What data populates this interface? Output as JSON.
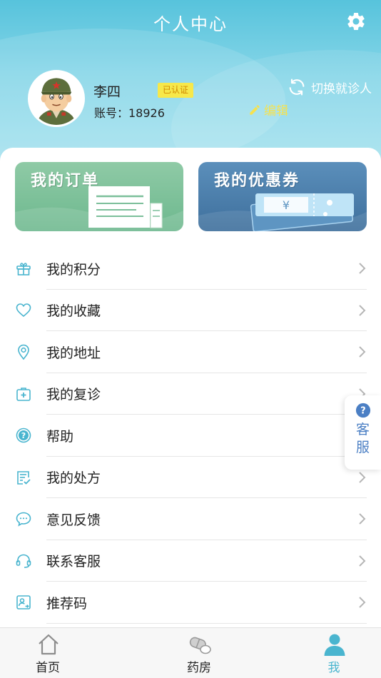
{
  "header": {
    "title": "个人中心",
    "settings_icon": "gear-icon"
  },
  "profile": {
    "name": "李四",
    "badge": "已认证",
    "account_line": "账号：18926",
    "switch_label": "切换就诊人",
    "edit_label": "编辑"
  },
  "promos": {
    "orders_title": "我的订单",
    "coupons_title": "我的优惠券"
  },
  "menu": {
    "items": [
      {
        "label": "我的积分",
        "icon": "gift-icon"
      },
      {
        "label": "我的收藏",
        "icon": "heart-icon"
      },
      {
        "label": "我的地址",
        "icon": "location-pin-icon"
      },
      {
        "label": "我的复诊",
        "icon": "medical-kit-icon"
      },
      {
        "label": "帮助",
        "icon": "help-circle-icon"
      },
      {
        "label": "我的处方",
        "icon": "prescription-icon"
      },
      {
        "label": "意见反馈",
        "icon": "chat-bubble-icon"
      },
      {
        "label": "联系客服",
        "icon": "headset-icon"
      },
      {
        "label": "推荐码",
        "icon": "referral-code-icon"
      }
    ]
  },
  "float_service": {
    "label": "客服"
  },
  "tabbar": {
    "items": [
      {
        "label": "首页",
        "icon": "home-icon"
      },
      {
        "label": "药房",
        "icon": "pills-icon"
      },
      {
        "label": "我",
        "icon": "person-icon"
      }
    ],
    "active_index": 2
  },
  "colors": {
    "header_gradient_top": "#57c3dc",
    "accent": "#4ab5cf",
    "badge_bg": "#f7e84a",
    "edit_color": "#f6e24f",
    "service_text": "#4b7fc4"
  }
}
